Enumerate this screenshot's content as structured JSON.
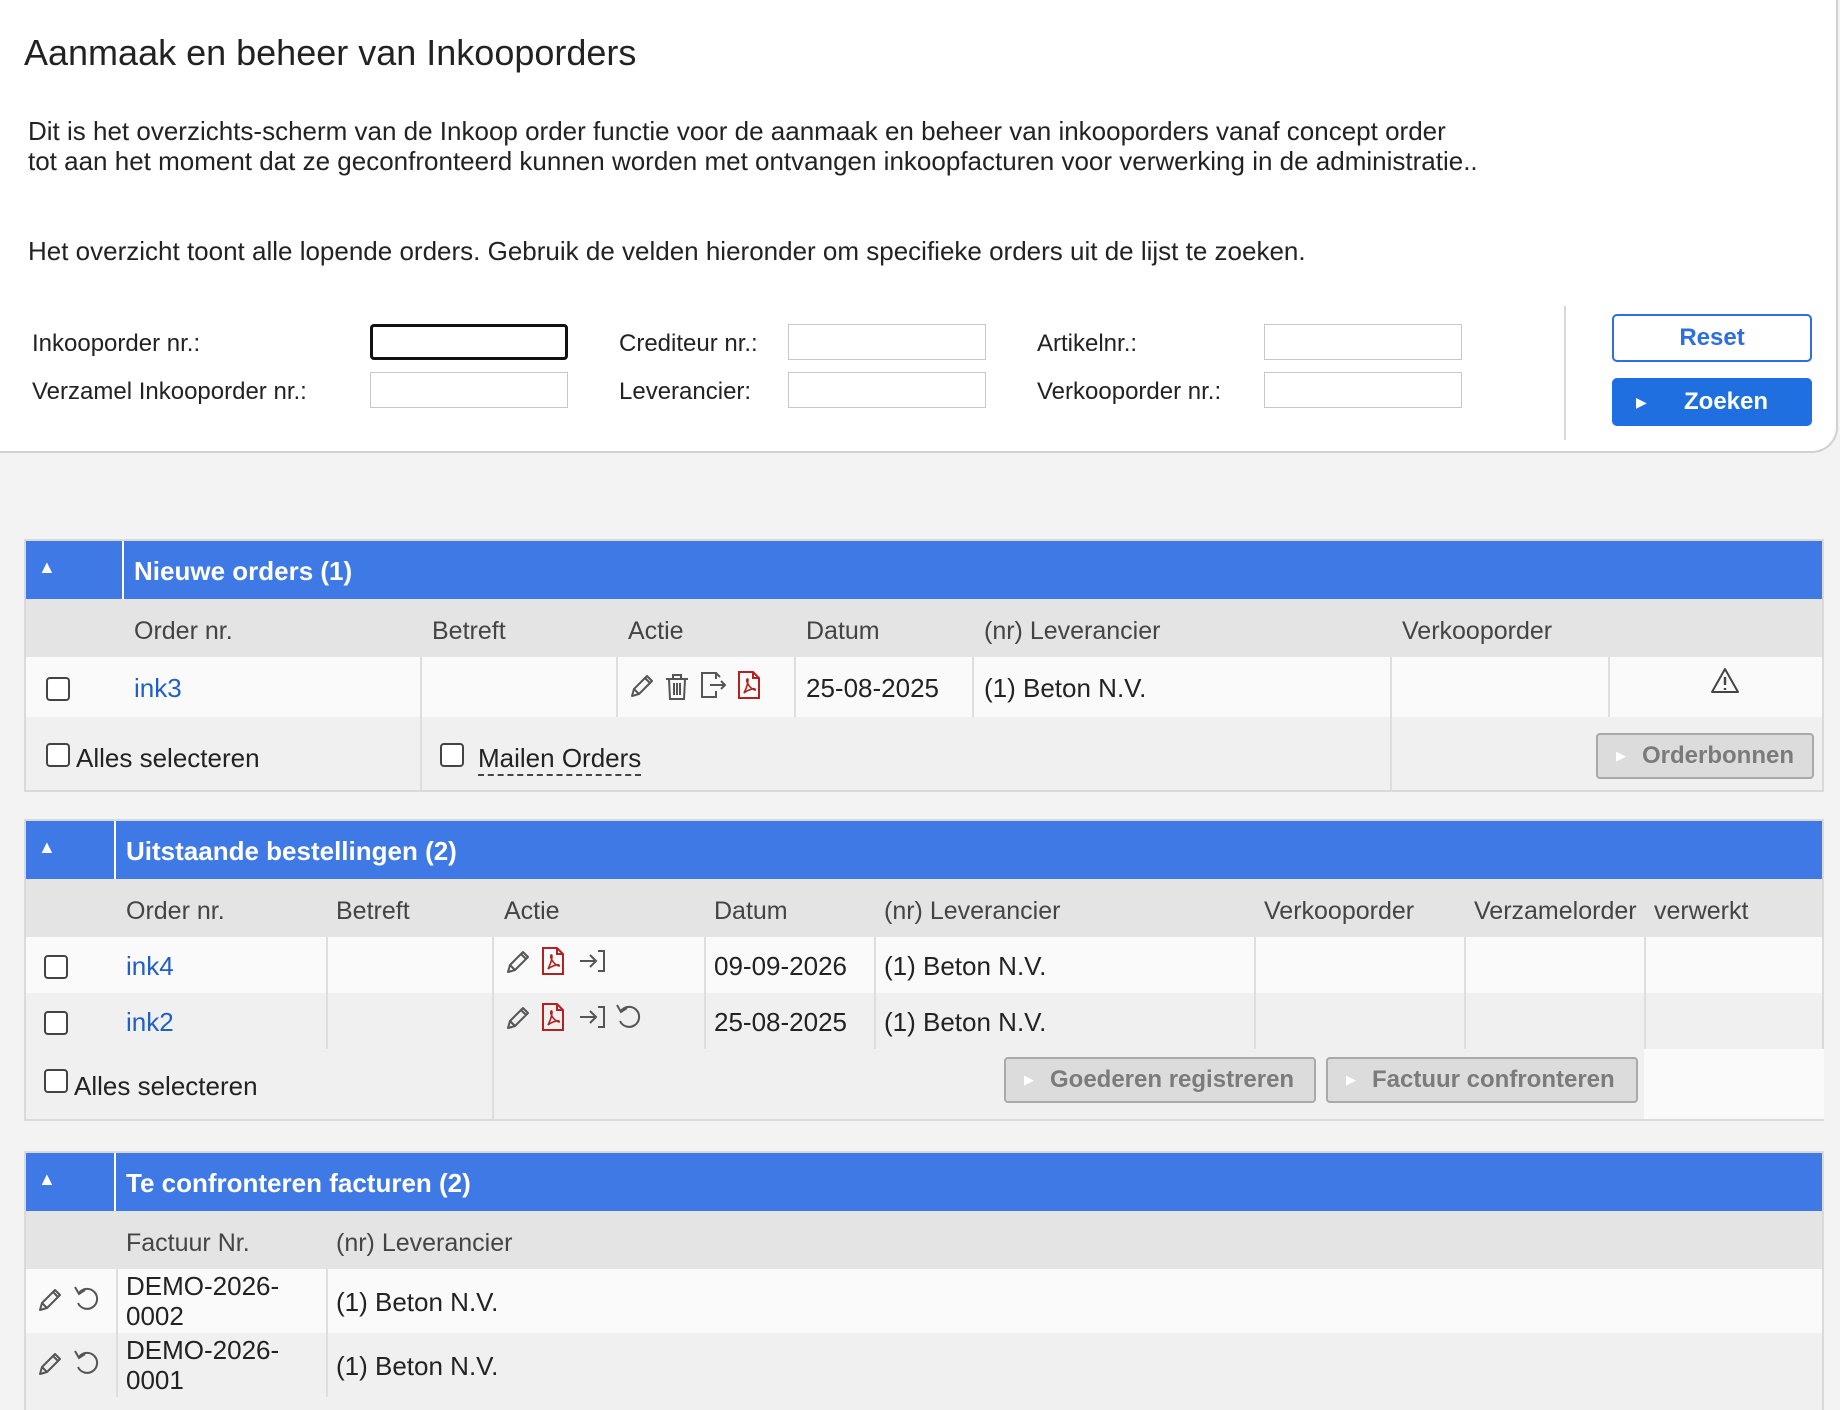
{
  "page": {
    "title": "Aanmaak en beheer van Inkooporders",
    "intro_line1": "Dit is het overzichts-scherm van de Inkoop order functie voor de aanmaak en beheer van inkooporders vanaf concept order",
    "intro_line2": "tot aan het moment dat ze geconfronteerd kunnen worden met ontvangen inkoopfacturen voor verwerking in de administratie..",
    "hint": "Het overzicht toont alle lopende orders. Gebruik de velden hieronder om specifieke orders uit de lijst te zoeken."
  },
  "search": {
    "inkooporder_label": "Inkooporder nr.:",
    "verzamel_label": "Verzamel Inkooporder nr.:",
    "crediteur_label": "Crediteur nr.:",
    "leverancier_label": "Leverancier:",
    "artikel_label": "Artikelnr.:",
    "verkooporder_label": "Verkooporder nr.:",
    "inkooporder_value": "",
    "verzamel_value": "",
    "crediteur_value": "",
    "leverancier_value": "",
    "artikel_value": "",
    "verkooporder_value": "",
    "reset_label": "Reset",
    "zoeken_label": "Zoeken"
  },
  "nieuwe": {
    "title": "Nieuwe orders (1)",
    "columns": [
      "Order nr.",
      "Betreft",
      "Actie",
      "Datum",
      "(nr)  Leverancier",
      "Verkooporder"
    ],
    "rows": [
      {
        "order": "ink3",
        "betreft": "",
        "datum": "25-08-2025",
        "leverancier": "(1) Beton N.V.",
        "verkooporder": "",
        "warning": true
      }
    ],
    "select_all": "Alles selecteren",
    "mail_orders": "Mailen Orders",
    "orderbonnen": "Orderbonnen"
  },
  "uitstaande": {
    "title": "Uitstaande bestellingen (2)",
    "columns": [
      "Order nr.",
      "Betreft",
      "Actie",
      "Datum",
      "(nr)  Leverancier",
      "Verkooporder",
      "Verzamelorder",
      "verwerkt"
    ],
    "rows": [
      {
        "order": "ink4",
        "betreft": "",
        "datum": "09-09-2026",
        "leverancier": "(1) Beton N.V.",
        "verkooporder": "",
        "verzamelorder": ""
      },
      {
        "order": "ink2",
        "betreft": "",
        "datum": "25-08-2025",
        "leverancier": "(1) Beton N.V.",
        "verkooporder": "",
        "verzamelorder": ""
      }
    ],
    "select_all": "Alles selecteren",
    "goederen": "Goederen registreren",
    "factuur": "Factuur confronteren"
  },
  "facturen": {
    "title": "Te confronteren facturen (2)",
    "columns": [
      "Factuur Nr.",
      "(nr) Leverancier"
    ],
    "rows": [
      {
        "nr_line1": "DEMO-2026-",
        "nr_line2": "0002",
        "leverancier": "(1) Beton N.V."
      },
      {
        "nr_line1": "DEMO-2026-",
        "nr_line2": "0001",
        "leverancier": "(1) Beton N.V."
      }
    ]
  },
  "icons": {
    "collapse": "triangle-up-icon",
    "edit": "pencil-icon",
    "delete": "trash-icon",
    "export": "export-icon",
    "pdf": "pdf-icon",
    "receive": "arrow-into-icon",
    "undo": "undo-icon",
    "warning": "warning-icon"
  },
  "colors": {
    "header_blue": "#3f79e6",
    "button_blue": "#1f6fe0",
    "link_blue": "#1f5fc6",
    "pdf_red": "#b22222"
  }
}
